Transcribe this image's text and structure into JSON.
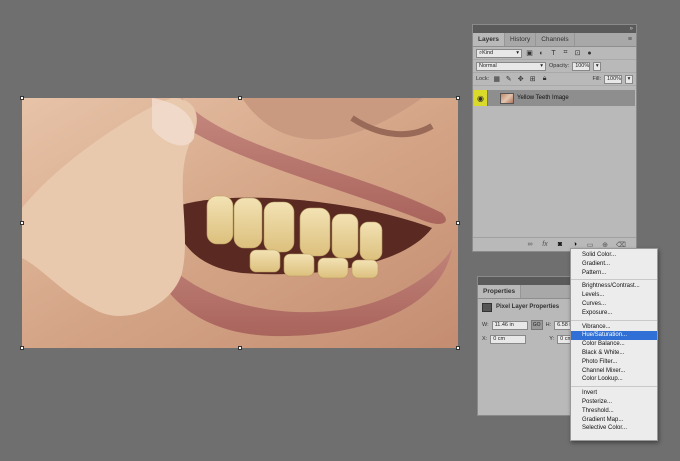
{
  "layers_panel": {
    "tabs": [
      "Layers",
      "History",
      "Channels"
    ],
    "menu_icon": "hamburger-menu-icon",
    "filter_kind": "Kind",
    "blend_mode": "Normal",
    "opacity_label": "Opacity:",
    "opacity_value": "100%",
    "lock_label": "Lock:",
    "fill_label": "Fill:",
    "fill_value": "100%",
    "layer": {
      "name": "Yellow Teeth Image",
      "visible": true
    }
  },
  "properties_panel": {
    "tab": "Properties",
    "title": "Pixel Layer Properties",
    "w_label": "W:",
    "w_value": "11.46 in",
    "link_label": "GO",
    "h_label": "H:",
    "h_value": "6.58 i",
    "x_label": "X:",
    "x_value": "0 cm",
    "y_label": "Y:",
    "y_value": "0 cm"
  },
  "adjustment_menu": {
    "groups": [
      [
        "Solid Color...",
        "Gradient...",
        "Pattern..."
      ],
      [
        "Brightness/Contrast...",
        "Levels...",
        "Curves...",
        "Exposure..."
      ],
      [
        "Vibrance...",
        "Hue/Saturation...",
        "Color Balance...",
        "Black & White...",
        "Photo Filter...",
        "Channel Mixer...",
        "Color Lookup..."
      ],
      [
        "Invert",
        "Posterize...",
        "Threshold...",
        "Gradient Map...",
        "Selective Color..."
      ]
    ],
    "selected": "Hue/Saturation..."
  },
  "colors": {
    "workspace": "#6f6f6f",
    "panel": "#b9b9b9",
    "highlight": "#2f6fd6",
    "visibility": "#dada2a"
  }
}
